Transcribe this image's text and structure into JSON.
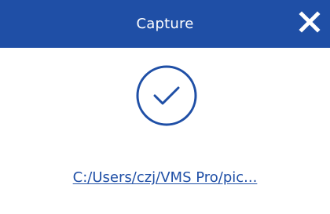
{
  "dialog": {
    "title": "Capture",
    "close_icon": "close-icon",
    "status_icon": "check-circle-icon",
    "saved_path": "C:/Users/czj/VMS Pro/pic...",
    "colors": {
      "titlebar": "#1f4fa6",
      "title_text": "#ffffff",
      "icon": "#1f4fa6",
      "link": "#1f4fa6",
      "background": "#ffffff"
    }
  }
}
